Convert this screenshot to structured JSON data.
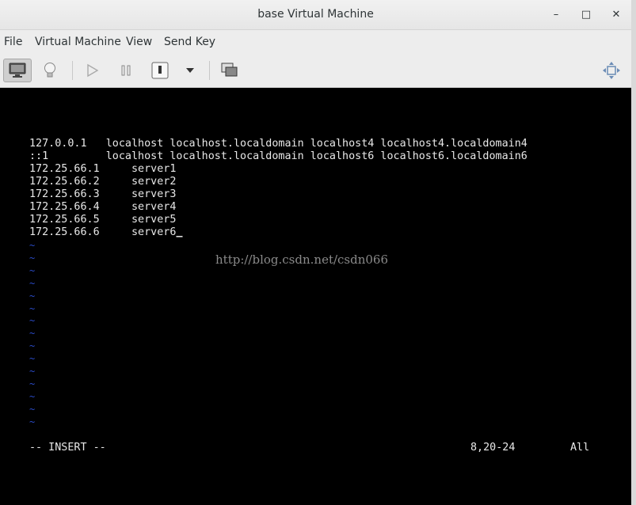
{
  "window": {
    "title": "base Virtual Machine",
    "minimize": "–",
    "maximize": "□",
    "close": "✕"
  },
  "menu": [
    "File",
    "Virtual Machine",
    "View",
    "Send Key"
  ],
  "toolbar": {
    "icons": [
      "monitor-icon",
      "lightbulb-icon",
      "play-icon",
      "pause-icon",
      "power-icon",
      "dropdown-arrow-icon",
      "snapshots-icon",
      "fullscreen-icon"
    ]
  },
  "console": {
    "lines": [
      "127.0.0.1   localhost localhost.localdomain localhost4 localhost4.localdomain4",
      "::1         localhost localhost.localdomain localhost6 localhost6.localdomain6",
      "172.25.66.1     server1",
      "172.25.66.2     server2",
      "172.25.66.3     server3",
      "172.25.66.4     server4",
      "172.25.66.5     server5",
      "172.25.66.6     server6"
    ],
    "cursor": "_",
    "tilde": "~",
    "tilde_count": 15,
    "watermark": "http://blog.csdn.net/csdn066",
    "status_mode": "-- INSERT --",
    "status_pos": "8,20-24",
    "status_all": "All",
    "colors": {
      "text": "#e8e8e8",
      "tilde": "#2a4bc8",
      "background": "#000000"
    }
  }
}
